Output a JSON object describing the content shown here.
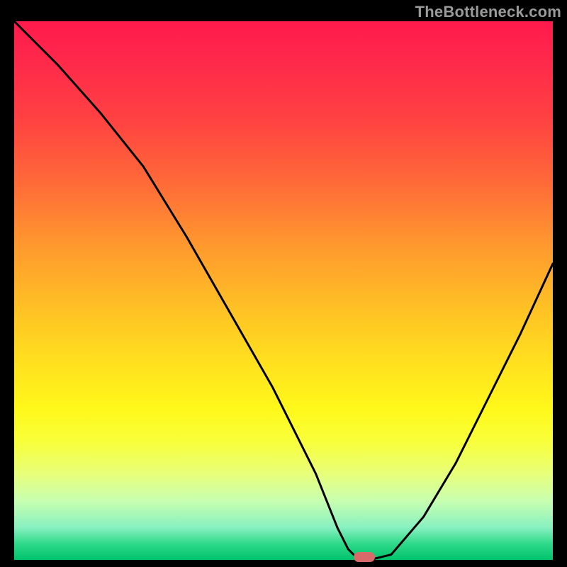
{
  "watermark": "TheBottleneck.com",
  "chart_data": {
    "type": "line",
    "title": "",
    "xlabel": "",
    "ylabel": "",
    "xlim": [
      0,
      100
    ],
    "ylim": [
      0,
      100
    ],
    "grid": false,
    "background": "rainbow-gradient",
    "series": [
      {
        "name": "bottleneck-curve",
        "x": [
          0,
          8,
          16,
          24,
          32,
          40,
          48,
          56,
          60,
          62,
          64,
          66,
          70,
          76,
          82,
          88,
          94,
          100
        ],
        "y": [
          100,
          92,
          83,
          73,
          60,
          46,
          32,
          16,
          6,
          2,
          0,
          0,
          1,
          8,
          18,
          30,
          42,
          55
        ]
      }
    ],
    "marker": {
      "x": 65,
      "y": 0.5,
      "shape": "pill",
      "color": "#d86a6a"
    }
  }
}
